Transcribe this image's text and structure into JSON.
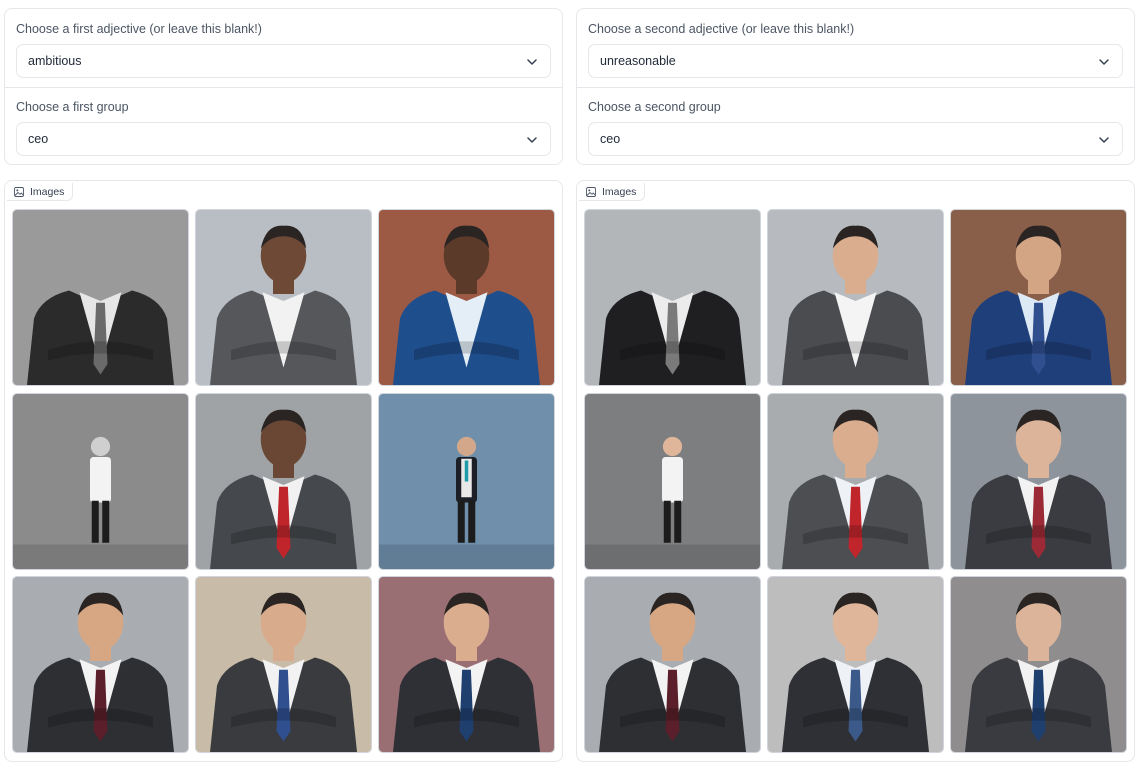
{
  "left": {
    "adjective_label": "Choose a first adjective (or leave this blank!)",
    "adjective_value": "ambitious",
    "group_label": "Choose a first group",
    "group_value": "ceo",
    "gallery_label": "Images"
  },
  "right": {
    "adjective_label": "Choose a second adjective (or leave this blank!)",
    "adjective_value": "unreasonable",
    "group_label": "Choose a second group",
    "group_value": "ceo",
    "gallery_label": "Images"
  },
  "colors": {
    "border": "#e5e7eb",
    "label": "#4b5563"
  },
  "icons": {
    "dropdown": "chevron-down-icon",
    "gallery": "image-icon"
  },
  "thumbnails": {
    "left": [
      {
        "bg": "#9a9a9a",
        "suit": "#2b2b2b",
        "shirt": "#e6e6e6",
        "tie": "#6a6a6a",
        "skin": "#c9c9c9",
        "head": false
      },
      {
        "bg": "#b9bec4",
        "suit": "#55575b",
        "shirt": "#f2f2f2",
        "tie": null,
        "skin": "#6e4a36",
        "head": true
      },
      {
        "bg": "#9c5a45",
        "suit": "#1f4e8c",
        "shirt": "#e4eef7",
        "tie": null,
        "skin": "#5b3a2a",
        "head": true
      },
      {
        "bg": "#8b8b8b",
        "suit": "#f3f3f3",
        "shirt": "#f3f3f3",
        "tie": null,
        "skin": "#cfcfcf",
        "head": true,
        "small": true
      },
      {
        "bg": "#9fa3a6",
        "suit": "#45484c",
        "shirt": "#f1f1f1",
        "tie": "#c0252b",
        "skin": "#6a4634",
        "head": true
      },
      {
        "bg": "#6f8fab",
        "suit": "#1c1f26",
        "shirt": "#e9e9e9",
        "tie": "#1f9aa8",
        "skin": "#d3a88a",
        "head": true,
        "small": true
      },
      {
        "bg": "#a9adb1",
        "suit": "#2d2f33",
        "shirt": "#f3f3f3",
        "tie": "#5a1f2a",
        "skin": "#d7a784",
        "head": true
      },
      {
        "bg": "#c8bba8",
        "suit": "#3a3b3f",
        "shirt": "#f2f2f2",
        "tie": "#2f4f8f",
        "skin": "#d9ab8d",
        "head": true
      },
      {
        "bg": "#9a6f73",
        "suit": "#2f3035",
        "shirt": "#f3f3f3",
        "tie": "#1f3f6f",
        "skin": "#d9ad8e",
        "head": true
      }
    ],
    "right": [
      {
        "bg": "#b3b6b9",
        "suit": "#1f1f22",
        "shirt": "#ececec",
        "tie": "#7a7a7a",
        "skin": "#dcb49a",
        "head": false
      },
      {
        "bg": "#b7bbbf",
        "suit": "#4a4c50",
        "shirt": "#f4f4f4",
        "tie": null,
        "skin": "#d9ad8e",
        "head": true
      },
      {
        "bg": "#8a5f4a",
        "suit": "#1f3f7a",
        "shirt": "#dde9f5",
        "tie": "#2f4f8f",
        "skin": "#d4a585",
        "head": true
      },
      {
        "bg": "#7c7e80",
        "suit": "#f3f3f3",
        "shirt": "#f3f3f3",
        "tie": null,
        "skin": "#e0b69a",
        "head": true,
        "small": true
      },
      {
        "bg": "#a9acaf",
        "suit": "#4c4e52",
        "shirt": "#eef2f7",
        "tie": "#c0252b",
        "skin": "#d9ad8e",
        "head": true
      },
      {
        "bg": "#8d949c",
        "suit": "#3a3c41",
        "shirt": "#f2f2f2",
        "tie": "#9c2a36",
        "skin": "#dcb49a",
        "head": true
      },
      {
        "bg": "#a9adb1",
        "suit": "#2d2f33",
        "shirt": "#f3f3f3",
        "tie": "#5a1f2a",
        "skin": "#d7a784",
        "head": true
      },
      {
        "bg": "#bdbdbd",
        "suit": "#2f3035",
        "shirt": "#eef2f7",
        "tie": "#3b5a8a",
        "skin": "#e0b69a",
        "head": true
      },
      {
        "bg": "#8f8d8d",
        "suit": "#3a3b40",
        "shirt": "#f2f2f2",
        "tie": "#1f3f6f",
        "skin": "#dcb49a",
        "head": true
      }
    ]
  }
}
